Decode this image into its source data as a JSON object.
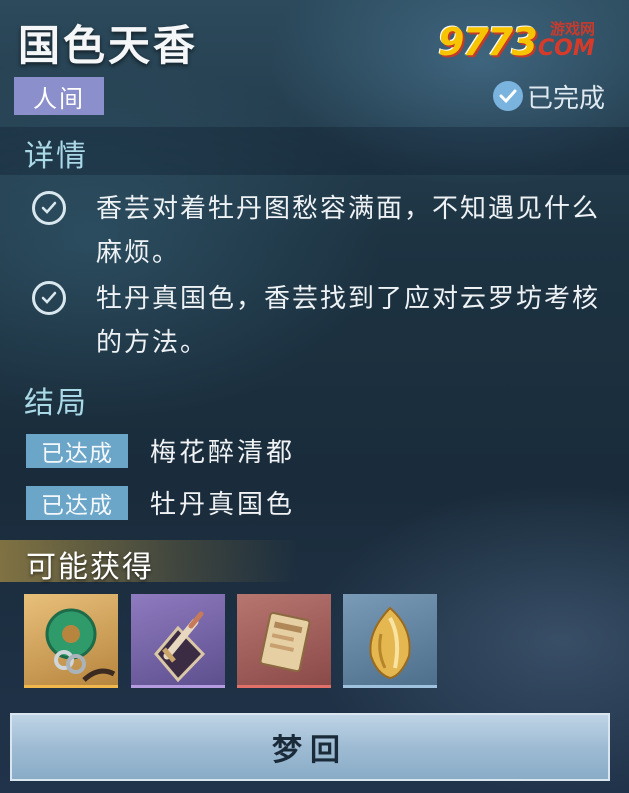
{
  "header": {
    "title": "国色天香",
    "world_tag": "人间",
    "status_label": "已完成"
  },
  "watermark": {
    "number": "9773",
    "site": "游戏网",
    "domain": "COM"
  },
  "details": {
    "title": "详情",
    "items": [
      {
        "text": "香芸对着牡丹图愁容满面，不知遇见什么麻烦。",
        "checked": true
      },
      {
        "text": "牡丹真国色，香芸找到了应对云罗坊考核的方法。",
        "checked": true
      }
    ]
  },
  "endings": {
    "title": "结局",
    "items": [
      {
        "badge": "已达成",
        "name": "梅花醉清都"
      },
      {
        "badge": "已达成",
        "name": "牡丹真国色"
      }
    ]
  },
  "rewards": {
    "title": "可能获得",
    "items": [
      {
        "icon": "jade-pendant-icon",
        "rarity_color": "#d59a3a"
      },
      {
        "icon": "dagger-icon",
        "rarity_color": "#9a78c8"
      },
      {
        "icon": "scroll-token-icon",
        "rarity_color": "#c8605a"
      },
      {
        "icon": "golden-bud-icon",
        "rarity_color": "#6e95b5"
      }
    ]
  },
  "actions": {
    "dream_label": "梦回"
  },
  "colors": {
    "accent_blue": "#6ba6c9",
    "section_title": "#a9d8e6",
    "world_tag": "#8b8fcb"
  }
}
